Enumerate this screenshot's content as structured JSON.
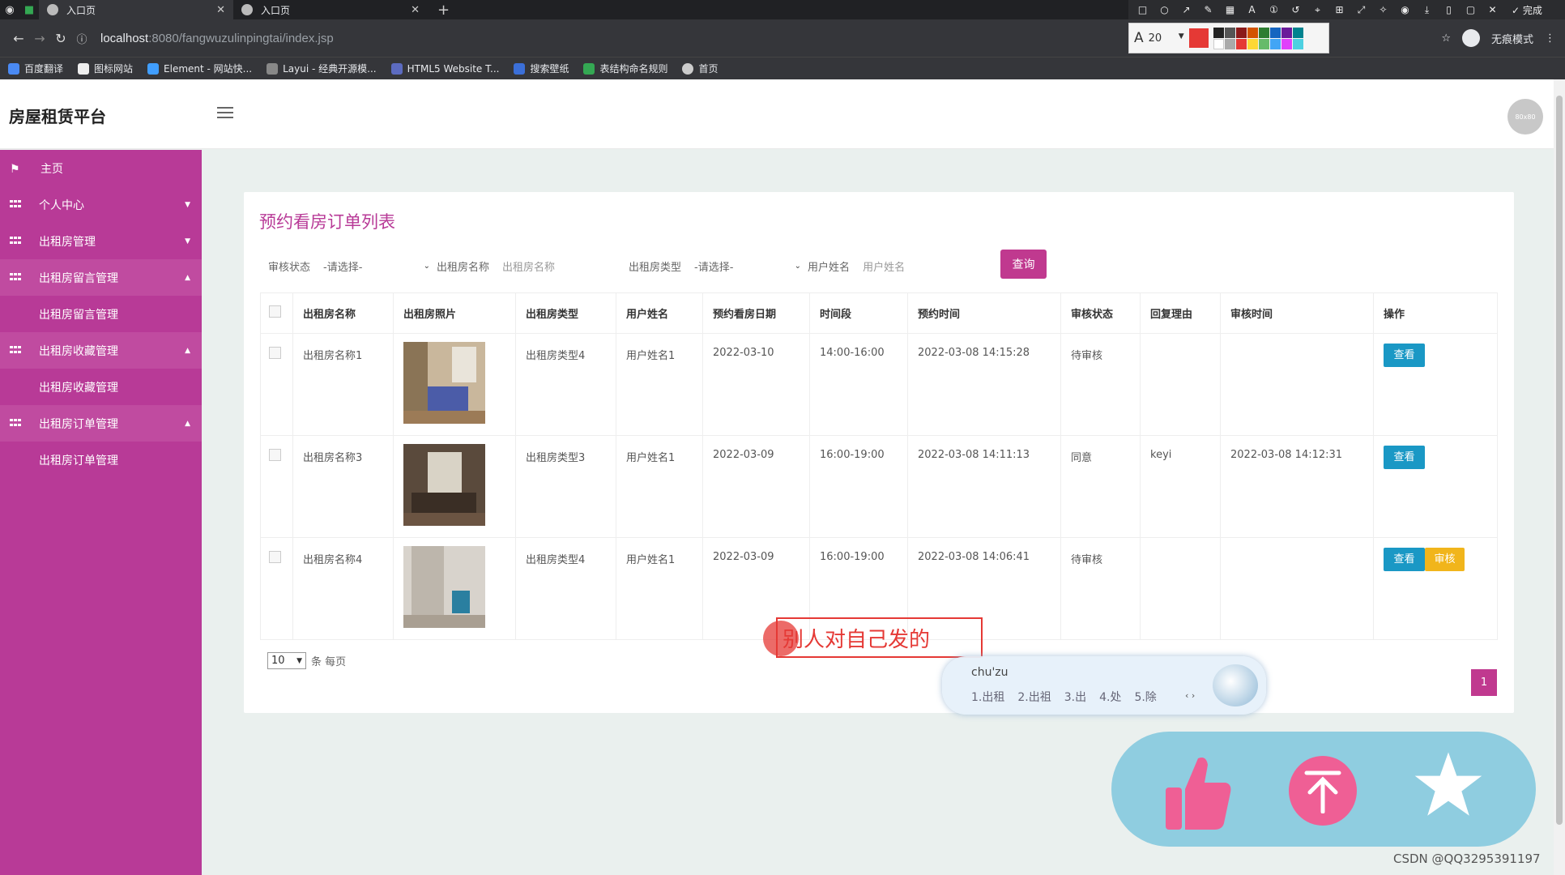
{
  "browser": {
    "tabs": [
      {
        "title": "入口页"
      },
      {
        "title": "入口页"
      }
    ],
    "url_host": "localhost",
    "url_rest": ":8080/fangwuzulinpingtai/index.jsp",
    "done_label": "完成",
    "font_size_value": "20",
    "incognito_label": "无痕模式",
    "bookmarks": [
      "百度翻译",
      "图标网站",
      "Element - 网站快...",
      "Layui - 经典开源模...",
      "HTML5 Website T...",
      "搜索壁纸",
      "表结构命名规则",
      "首页"
    ]
  },
  "app": {
    "brand": "房屋租赁平台",
    "avatar_text": "80x80"
  },
  "sidebar": {
    "items": [
      {
        "label": "主页"
      },
      {
        "label": "个人中心"
      },
      {
        "label": "出租房管理"
      },
      {
        "label": "出租房留言管理",
        "sub": "出租房留言管理"
      },
      {
        "label": "出租房收藏管理",
        "sub": "出租房收藏管理"
      },
      {
        "label": "出租房订单管理",
        "sub": "出租房订单管理"
      }
    ]
  },
  "main": {
    "title": "预约看房订单列表",
    "filters": {
      "status_label": "审核状态",
      "status_value": "-请选择-",
      "name_label": "出租房名称",
      "name_placeholder": "出租房名称",
      "type_label": "出租房类型",
      "type_value": "-请选择-",
      "user_label": "用户姓名",
      "user_placeholder": "用户姓名",
      "query_button": "查询"
    },
    "table": {
      "headers": [
        "出租房名称",
        "出租房照片",
        "出租房类型",
        "用户姓名",
        "预约看房日期",
        "时间段",
        "预约时间",
        "审核状态",
        "回复理由",
        "审核时间",
        "操作"
      ],
      "rows": [
        {
          "name": "出租房名称1",
          "type": "出租房类型4",
          "user": "用户姓名1",
          "date": "2022-03-10",
          "slot": "14:00-16:00",
          "time": "2022-03-08 14:15:28",
          "status": "待审核",
          "reply": "",
          "audit_time": "",
          "view": "查看"
        },
        {
          "name": "出租房名称3",
          "type": "出租房类型3",
          "user": "用户姓名1",
          "date": "2022-03-09",
          "slot": "16:00-19:00",
          "time": "2022-03-08 14:11:13",
          "status": "同意",
          "reply": "keyi",
          "audit_time": "2022-03-08 14:12:31",
          "view": "查看"
        },
        {
          "name": "出租房名称4",
          "type": "出租房类型4",
          "user": "用户姓名1",
          "date": "2022-03-09",
          "slot": "16:00-19:00",
          "time": "2022-03-08 14:06:41",
          "status": "待审核",
          "reply": "",
          "audit_time": "",
          "view": "查看",
          "audit": "审核"
        }
      ]
    },
    "pager": {
      "size": "10",
      "size_suffix": "条 每页",
      "current_page": "1"
    }
  },
  "overlay": {
    "annotation_text": "别人对自己发的",
    "ime_pinyin": "chu'zu",
    "ime_candidates": [
      "1.出租",
      "2.出祖",
      "3.出",
      "4.处",
      "5.除"
    ]
  },
  "watermark": "CSDN @QQ3295391197",
  "colors": {
    "accent": "#b83a97",
    "button_view": "#1a98c5",
    "button_audit": "#f1b51b"
  }
}
